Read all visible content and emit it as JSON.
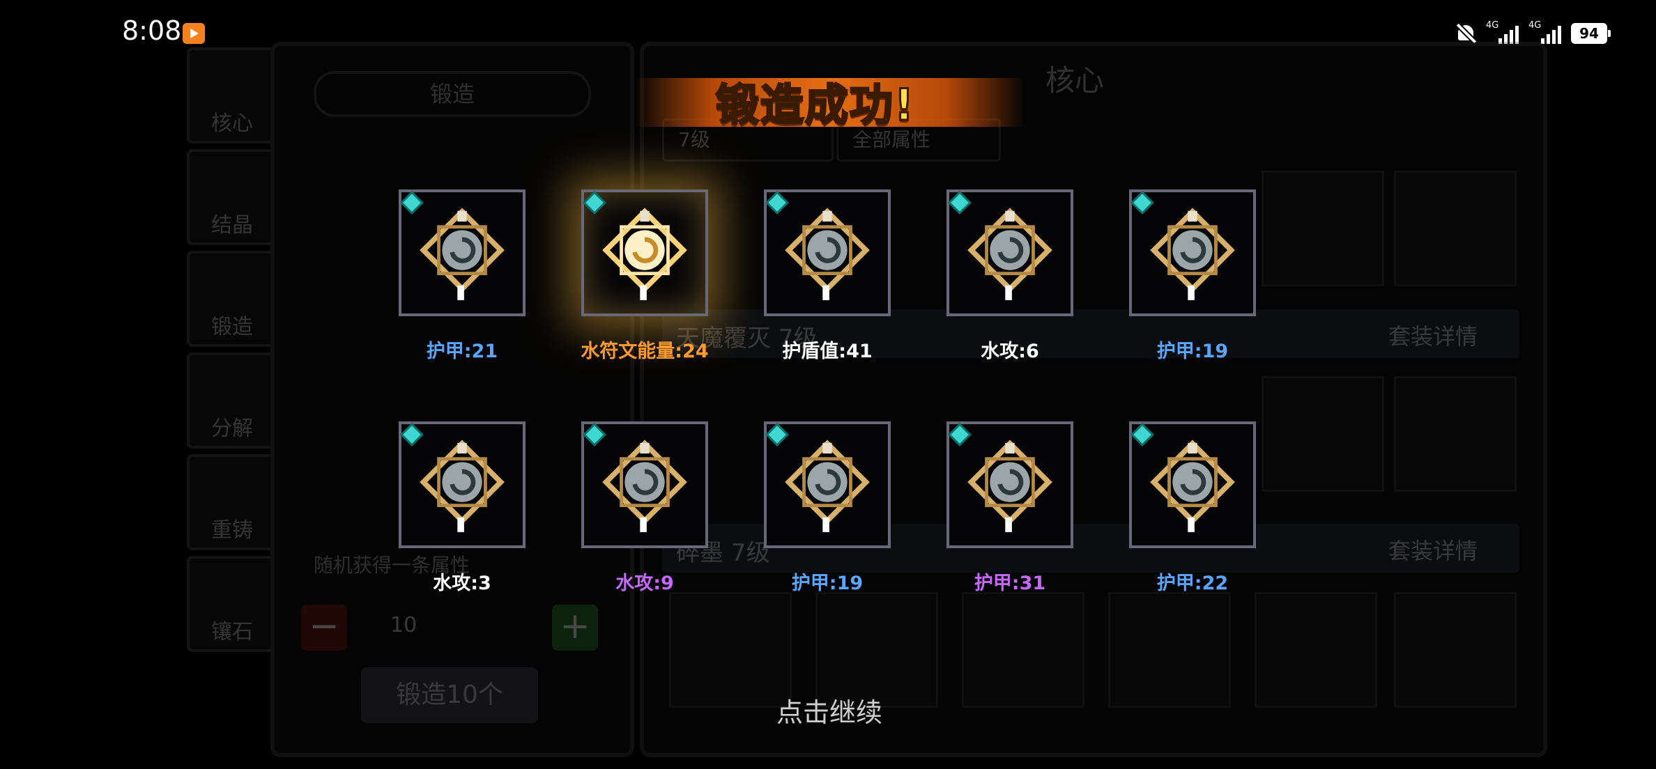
{
  "status_bar": {
    "time": "8:08",
    "signal1": "4G",
    "signal2": "4G",
    "battery": "94"
  },
  "background": {
    "tabs": [
      "核心",
      "结晶",
      "锻造",
      "分解",
      "重铸",
      "镶石"
    ],
    "forge_title": "锻造",
    "core_title": "核心",
    "filter_level": "7级",
    "filter_attr": "全部属性",
    "sets": [
      {
        "name": "天魔覆灭 7级",
        "detail": "套装详情"
      },
      {
        "name": "碎墨 7级",
        "detail": "套装详情"
      }
    ],
    "random_text": "随机获得一条属性",
    "quantity": "10",
    "forge_button": "锻造10个"
  },
  "banner": {
    "title": "锻造成功!"
  },
  "results": [
    {
      "label": "护甲:21",
      "color": "#5aa5ff"
    },
    {
      "label": "水符文能量:24",
      "color": "#ff9b2e"
    },
    {
      "label": "护盾值:41",
      "color": "#ffffff"
    },
    {
      "label": "水攻:6",
      "color": "#ffffff"
    },
    {
      "label": "护甲:19",
      "color": "#5aa5ff"
    },
    {
      "label": "水攻:3",
      "color": "#ffffff"
    },
    {
      "label": "水攻:9",
      "color": "#c867ff"
    },
    {
      "label": "护甲:19",
      "color": "#5aa5ff"
    },
    {
      "label": "护甲:31",
      "color": "#c867ff"
    },
    {
      "label": "护甲:22",
      "color": "#5aa5ff"
    }
  ],
  "continue_text": "点击继续"
}
